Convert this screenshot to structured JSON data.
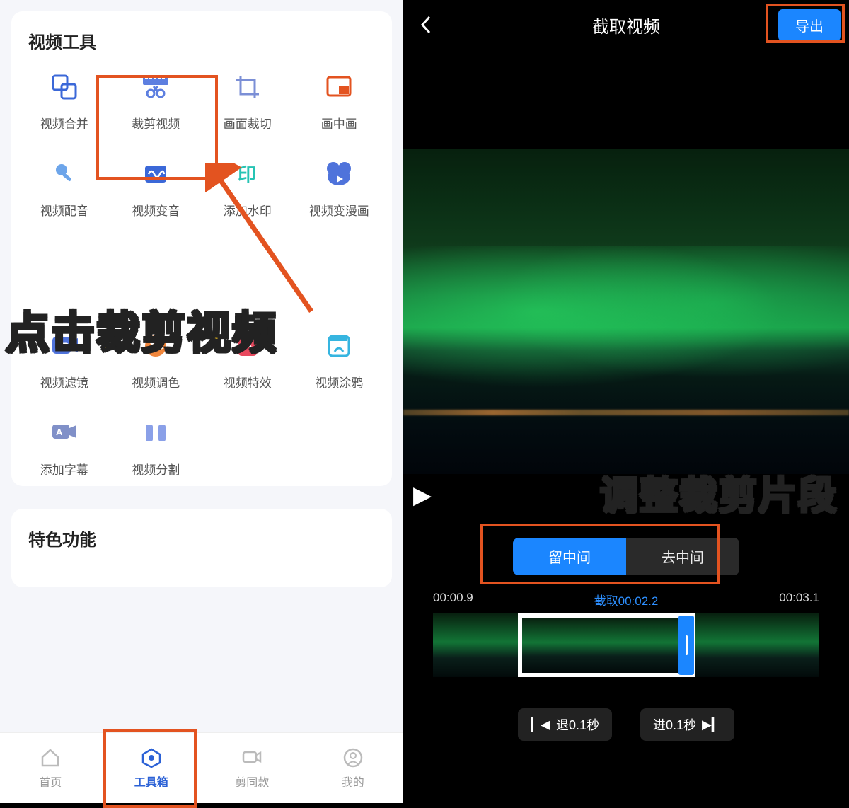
{
  "left": {
    "section_title": "视频工具",
    "tools_row1": [
      {
        "label": "视频合并",
        "icon": "merge"
      },
      {
        "label": "裁剪视频",
        "icon": "cut"
      },
      {
        "label": "画面裁切",
        "icon": "crop"
      },
      {
        "label": "画中画",
        "icon": "pip"
      }
    ],
    "tools_row2": [
      {
        "label": "视频配音",
        "icon": "mic"
      },
      {
        "label": "视频变音",
        "icon": "wave"
      },
      {
        "label": "添加水印",
        "icon": "watermark"
      },
      {
        "label": "视频变漫画",
        "icon": "cartoon"
      }
    ],
    "tools_row3": [
      {
        "label": "视频滤镜",
        "icon": "filter"
      },
      {
        "label": "视频调色",
        "icon": "palette"
      },
      {
        "label": "视频特效",
        "icon": "fx"
      },
      {
        "label": "视频涂鸦",
        "icon": "doodle"
      }
    ],
    "tools_row4": [
      {
        "label": "添加字幕",
        "icon": "subtitle"
      },
      {
        "label": "视频分割",
        "icon": "split"
      }
    ],
    "section2_title": "特色功能",
    "callout": "点击裁剪视频",
    "nav": [
      {
        "label": "首页"
      },
      {
        "label": "工具箱"
      },
      {
        "label": "剪同款"
      },
      {
        "label": "我的"
      }
    ]
  },
  "right": {
    "title": "截取视频",
    "export_label": "导出",
    "callout": "调整裁剪片段",
    "seg": {
      "keep": "留中间",
      "remove": "去中间"
    },
    "times": {
      "start": "00:00.9",
      "clip_prefix": "截取",
      "clip": "00:02.2",
      "end": "00:03.1"
    },
    "nudge": {
      "back": "退0.1秒",
      "fwd": "进0.1秒"
    }
  }
}
